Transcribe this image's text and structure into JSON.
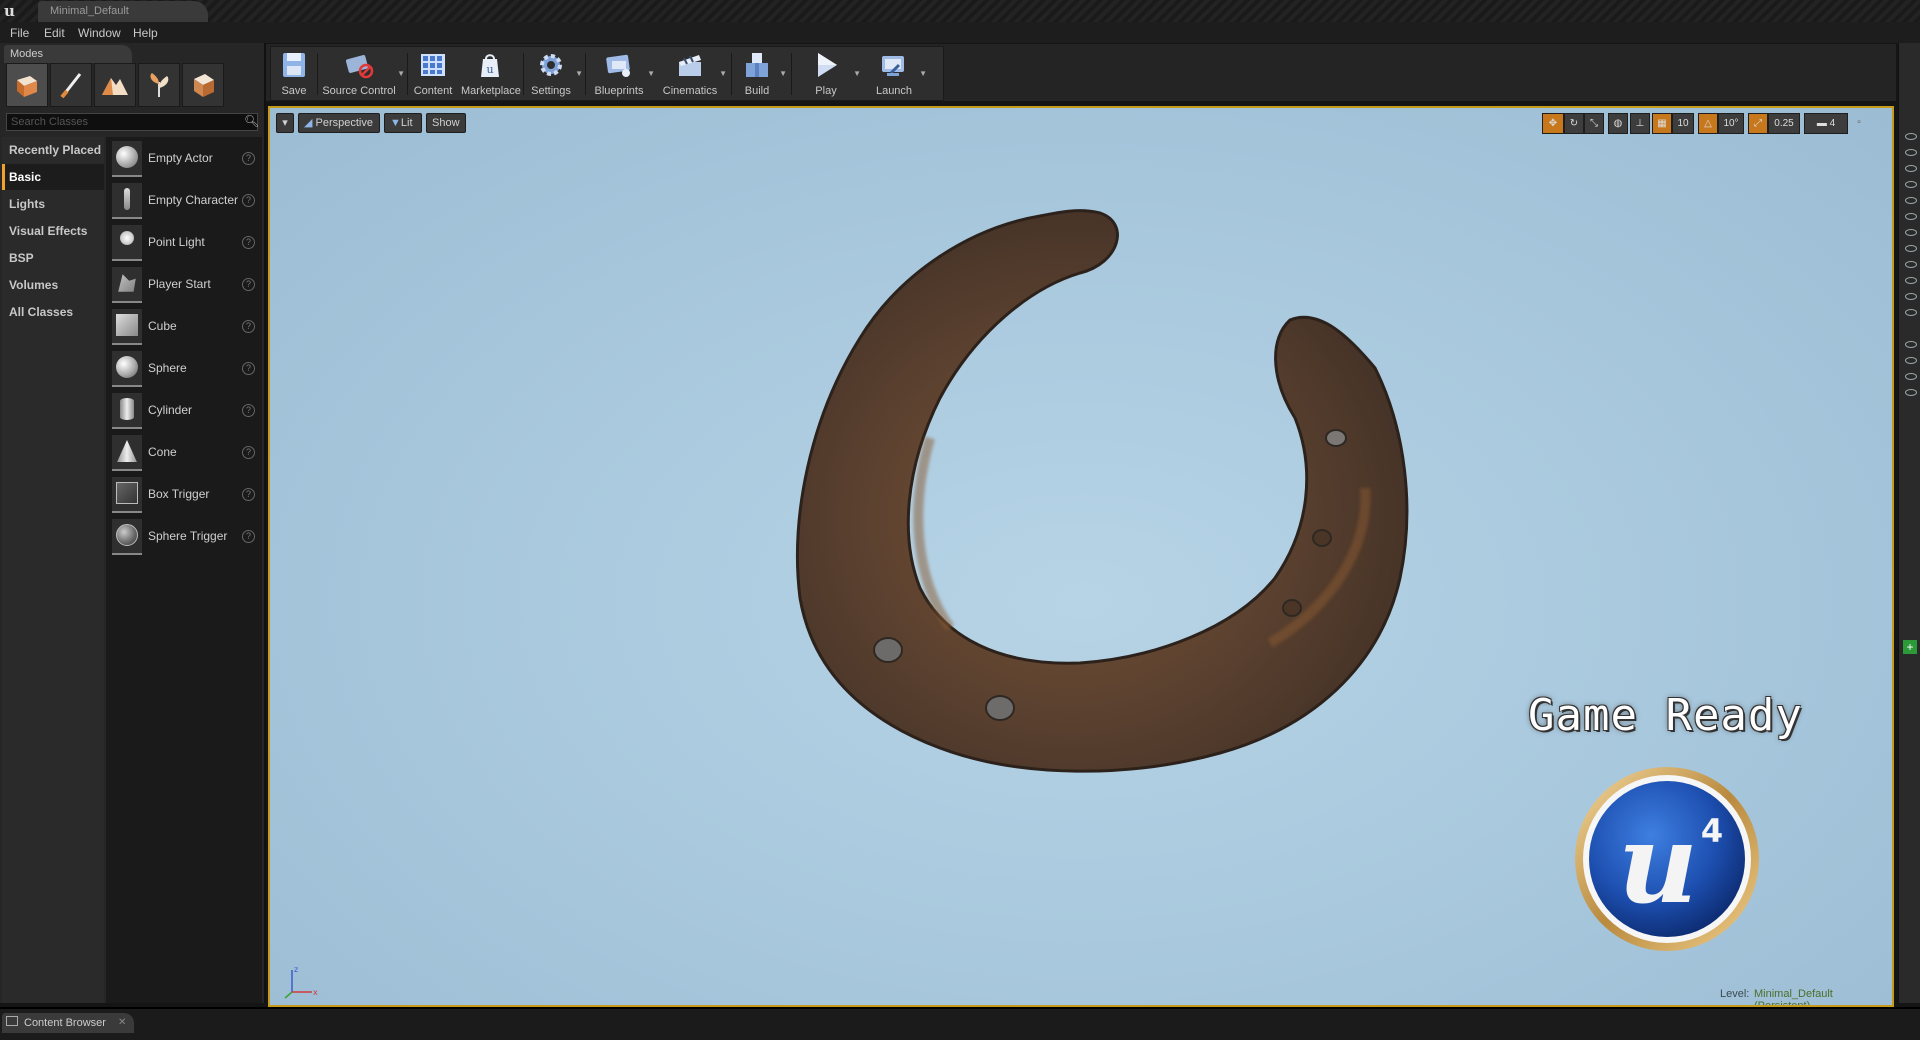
{
  "window": {
    "doc_tab": "Minimal_Default"
  },
  "menu": [
    "File",
    "Edit",
    "Window",
    "Help"
  ],
  "modes": {
    "tab_label": "Modes",
    "mode_icons": [
      "place-mode-icon",
      "paint-mode-icon",
      "landscape-mode-icon",
      "foliage-mode-icon",
      "geometry-mode-icon"
    ],
    "search_placeholder": "Search Classes",
    "categories": [
      "Recently Placed",
      "Basic",
      "Lights",
      "Visual Effects",
      "BSP",
      "Volumes",
      "All Classes"
    ],
    "selected_category": "Basic",
    "items": [
      "Empty Actor",
      "Empty Character",
      "Point Light",
      "Player Start",
      "Cube",
      "Sphere",
      "Cylinder",
      "Cone",
      "Box Trigger",
      "Sphere Trigger"
    ]
  },
  "toolbar": {
    "buttons": [
      "Save",
      "Source Control",
      "Content",
      "Marketplace",
      "Settings",
      "Blueprints",
      "Cinematics",
      "Build",
      "Play",
      "Launch"
    ]
  },
  "viewport": {
    "perspective_label": "Perspective",
    "lit_label": "Lit",
    "show_label": "Show",
    "grid_snap": "10",
    "rotation_snap": "10°",
    "scale_snap": "0.25",
    "camera_speed": "4",
    "overlay_text": "Game Ready",
    "level_prefix": "Level:",
    "level_name": "Minimal_Default (Persistent)",
    "logo_badge": "4"
  },
  "bottom": {
    "content_browser_tab": "Content Browser"
  },
  "colors": {
    "selection_accent": "#f0a12a",
    "viewport_border": "#c69a1b",
    "sky": "#a6c6dc"
  }
}
